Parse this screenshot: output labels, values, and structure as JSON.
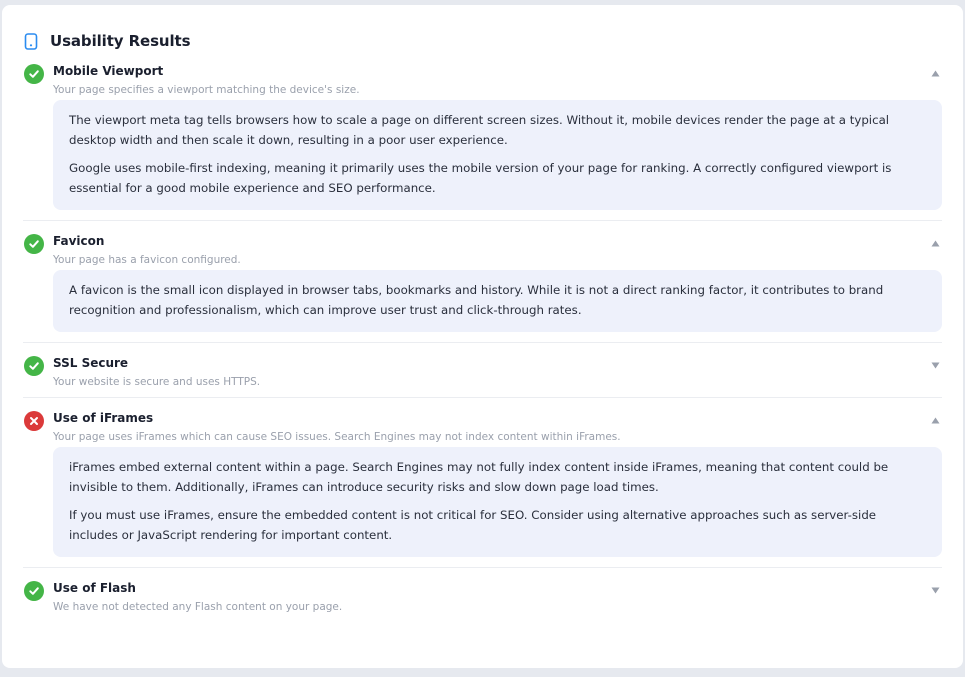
{
  "header": {
    "title": "Usability Results",
    "icon": "mobile-phone-icon"
  },
  "colors": {
    "pass": "#44b547",
    "fail": "#db3a3a",
    "info_bg": "#eef1fb",
    "muted": "#9aa0ac"
  },
  "items": [
    {
      "title": "Mobile Viewport",
      "description": "Your page specifies a viewport matching the device's size.",
      "status": "pass",
      "expanded": true,
      "details": [
        "The viewport meta tag tells browsers how to scale a page on different screen sizes. Without it, mobile devices render the page at a typical desktop width and then scale it down, resulting in a poor user experience.",
        "Google uses mobile-first indexing, meaning it primarily uses the mobile version of your page for ranking. A correctly configured viewport is essential for a good mobile experience and SEO performance."
      ]
    },
    {
      "title": "Favicon",
      "description": "Your page has a favicon configured.",
      "status": "pass",
      "expanded": true,
      "details": [
        "A favicon is the small icon displayed in browser tabs, bookmarks and history. While it is not a direct ranking factor, it contributes to brand recognition and professionalism, which can improve user trust and click-through rates."
      ]
    },
    {
      "title": "SSL Secure",
      "description": "Your website is secure and uses HTTPS.",
      "status": "pass",
      "expanded": false,
      "details": []
    },
    {
      "title": "Use of iFrames",
      "description": "Your page uses iFrames which can cause SEO issues. Search Engines may not index content within iFrames.",
      "status": "fail",
      "expanded": true,
      "details": [
        "iFrames embed external content within a page. Search Engines may not fully index content inside iFrames, meaning that content could be invisible to them. Additionally, iFrames can introduce security risks and slow down page load times.",
        "If you must use iFrames, ensure the embedded content is not critical for SEO. Consider using alternative approaches such as server-side includes or JavaScript rendering for important content."
      ]
    },
    {
      "title": "Use of Flash",
      "description": "We have not detected any Flash content on your page.",
      "status": "pass",
      "expanded": false,
      "details": []
    }
  ]
}
